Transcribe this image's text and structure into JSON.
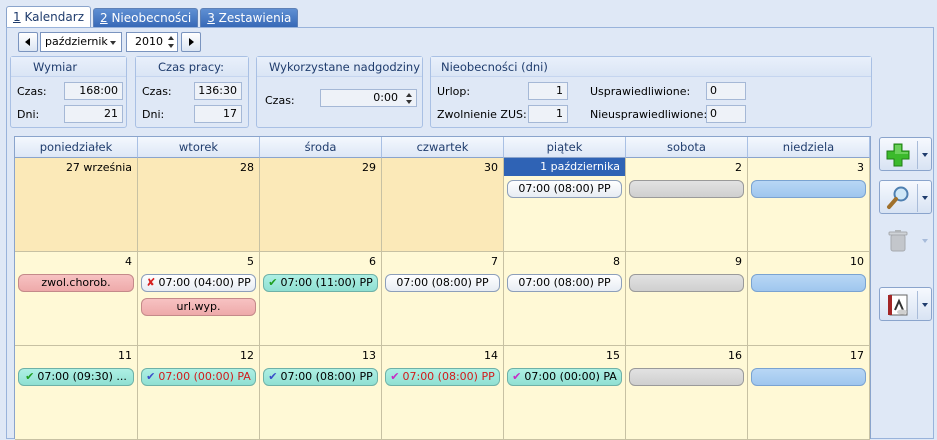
{
  "tabs": [
    {
      "key": "1",
      "label": " Kalendarz",
      "active": true
    },
    {
      "key": "2",
      "label": " Nieobecności",
      "active": false
    },
    {
      "key": "3",
      "label": " Zestawienia",
      "active": false
    }
  ],
  "nav": {
    "month": "październik",
    "year": "2010"
  },
  "wymiar": {
    "title": "Wymiar",
    "czas_label": "Czas:",
    "czas": "168:00",
    "dni_label": "Dni:",
    "dni": "21"
  },
  "czas_pracy": {
    "title": "Czas pracy:",
    "czas_label": "Czas:",
    "czas": "136:30",
    "dni_label": "Dni:",
    "dni": "17"
  },
  "nadgodziny": {
    "title": "Wykorzystane nadgodziny",
    "czas_label": "Czas:",
    "czas": "0:00"
  },
  "nieobecnosci": {
    "title": "Nieobecności (dni)",
    "urlop_label": "Urlop:",
    "urlop": "1",
    "zus_label": "Zwolnienie ZUS:",
    "zus": "1",
    "uspr_label": "Usprawiedliwione:",
    "uspr": "0",
    "nieuspr_label": "Nieusprawiedliwione:",
    "nieuspr": "0"
  },
  "calendar": {
    "days_of_week": [
      "poniedziałek",
      "wtorek",
      "środa",
      "czwartek",
      "piątek",
      "sobota",
      "niedziela"
    ],
    "weeks": [
      [
        {
          "num": "27 września",
          "other": true,
          "events": []
        },
        {
          "num": "28",
          "other": true,
          "events": []
        },
        {
          "num": "29",
          "other": true,
          "events": []
        },
        {
          "num": "30",
          "other": true,
          "events": []
        },
        {
          "num": "1 października",
          "today": true,
          "events": [
            {
              "text": "07:00 (08:00) PP",
              "style": "white"
            }
          ]
        },
        {
          "num": "2",
          "events": [
            {
              "text": "",
              "style": "gray"
            }
          ]
        },
        {
          "num": "3",
          "events": [
            {
              "text": "",
              "style": "blue"
            }
          ]
        }
      ],
      [
        {
          "num": "4",
          "events": [
            {
              "text": "zwol.chorob.",
              "style": "pink"
            }
          ]
        },
        {
          "num": "5",
          "events": [
            {
              "text": "07:00 (04:00) PP",
              "style": "white",
              "mark": "✘",
              "markColor": "red"
            },
            {
              "text": "url.wyp.",
              "style": "pink"
            }
          ]
        },
        {
          "num": "6",
          "events": [
            {
              "text": "07:00 (11:00) PP",
              "style": "teal",
              "mark": "✔",
              "markColor": "green"
            }
          ]
        },
        {
          "num": "7",
          "events": [
            {
              "text": "07:00 (08:00) PP",
              "style": "white"
            }
          ]
        },
        {
          "num": "8",
          "events": [
            {
              "text": "07:00 (08:00) PP",
              "style": "white"
            }
          ]
        },
        {
          "num": "9",
          "events": [
            {
              "text": "",
              "style": "gray"
            }
          ]
        },
        {
          "num": "10",
          "events": [
            {
              "text": "",
              "style": "blue"
            }
          ]
        }
      ],
      [
        {
          "num": "11",
          "events": [
            {
              "text": "07:00 (09:30) ...",
              "style": "teal",
              "mark": "✔",
              "markColor": "green"
            }
          ]
        },
        {
          "num": "12",
          "events": [
            {
              "text": "07:00 (00:00) PA",
              "style": "teal",
              "mark": "✔",
              "markColor": "blue",
              "textColor": "red"
            }
          ]
        },
        {
          "num": "13",
          "events": [
            {
              "text": "07:00 (08:00) PP",
              "style": "teal",
              "mark": "✔",
              "markColor": "blue"
            }
          ]
        },
        {
          "num": "14",
          "events": [
            {
              "text": "07:00 (08:00) PP",
              "style": "teal",
              "mark": "✔",
              "markColor": "magenta",
              "textColor": "red"
            }
          ]
        },
        {
          "num": "15",
          "events": [
            {
              "text": "07:00 (00:00) PA",
              "style": "teal",
              "mark": "✔",
              "markColor": "magenta"
            }
          ]
        },
        {
          "num": "16",
          "events": [
            {
              "text": "",
              "style": "gray"
            }
          ]
        },
        {
          "num": "17",
          "events": [
            {
              "text": "",
              "style": "blue"
            }
          ]
        }
      ]
    ]
  },
  "toolbar": {
    "add_icon": "plus-icon",
    "search_icon": "magnifier-icon",
    "delete_icon": "trash-icon",
    "report_icon": "report-icon"
  }
}
